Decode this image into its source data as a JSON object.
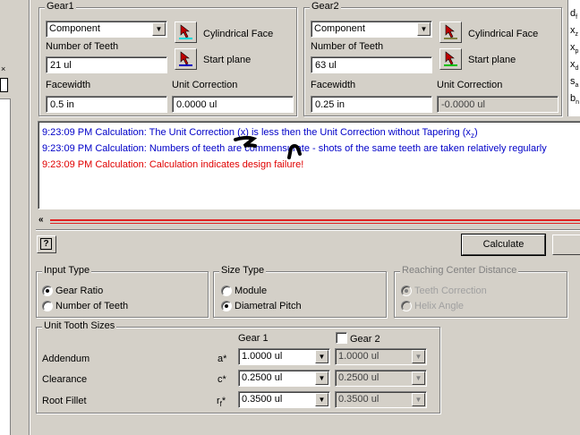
{
  "left": {
    "close_glyph": "×",
    "icon": "part-icon"
  },
  "gear1": {
    "title": "Gear1",
    "type_value": "Component",
    "face_label": "Cylindrical Face",
    "teeth_label": "Number of Teeth",
    "teeth_value": "21 ul",
    "plane_label": "Start plane",
    "facewidth_label": "Facewidth",
    "facewidth_value": "0.5 in",
    "unitcorr_label": "Unit Correction",
    "unitcorr_value": "0.0000 ul",
    "face_bar_color": "#00d8d8",
    "plane_bar_color": "#0000c0"
  },
  "gear2": {
    "title": "Gear2",
    "type_value": "Component",
    "face_label": "Cylindrical Face",
    "teeth_label": "Number of Teeth",
    "teeth_value": "63 ul",
    "plane_label": "Start plane",
    "facewidth_label": "Facewidth",
    "facewidth_value": "0.25 in",
    "unitcorr_label": "Unit Correction",
    "unitcorr_value": "-0.0000 ul",
    "face_bar_color": "#808040",
    "plane_bar_color": "#00c000"
  },
  "right_symbols": [
    {
      "base": "d",
      "sub": "f"
    },
    {
      "base": "x",
      "sub": "z"
    },
    {
      "base": "x",
      "sub": "p"
    },
    {
      "base": "x",
      "sub": "d"
    },
    {
      "base": "s",
      "sub": "a"
    },
    {
      "base": "b",
      "sub": "n"
    }
  ],
  "log": {
    "line1_prefix": "9:23:09 PM Calculation: The Unit Correction (x) is less then the Unit Correction without Tapering (x",
    "line1_sub": "z",
    "line1_suffix": ")",
    "line2": "9:23:09 PM Calculation: Numbers of teeth are commensurate - shots of the same teeth are taken relatively regularly",
    "line3": "9:23:09 PM Calculation: Calculation indicates design failure!",
    "info_color": "#0000c8",
    "error_color": "#e00000"
  },
  "toolbar": {
    "splitter_glyph": "«",
    "help_glyph": "?",
    "calculate_label": "Calculate"
  },
  "input_type": {
    "title": "Input Type",
    "options": [
      "Gear Ratio",
      "Number of Teeth"
    ],
    "selected": "Gear Ratio"
  },
  "size_type": {
    "title": "Size Type",
    "options": [
      "Module",
      "Diametral Pitch"
    ],
    "selected": "Diametral Pitch"
  },
  "reaching": {
    "title": "Reaching Center Distance",
    "options": [
      "Teeth Correction",
      "Helix Angle"
    ],
    "selected": "Teeth Correction"
  },
  "unit_tooth": {
    "title": "Unit Tooth Sizes",
    "gear1_header": "Gear 1",
    "gear2_header": "Gear 2",
    "rows": [
      {
        "label": "Addendum",
        "sym": "a*",
        "g1": "1.0000 ul",
        "g2": "1.0000 ul"
      },
      {
        "label": "Clearance",
        "sym": "c*",
        "g1": "0.2500 ul",
        "g2": "0.2500 ul"
      },
      {
        "label": "Root Fillet",
        "sym_base": "r",
        "sym_sub": "f",
        "sym_suffix": "*",
        "g1": "0.3500 ul",
        "g2": "0.3500 ul"
      }
    ]
  }
}
